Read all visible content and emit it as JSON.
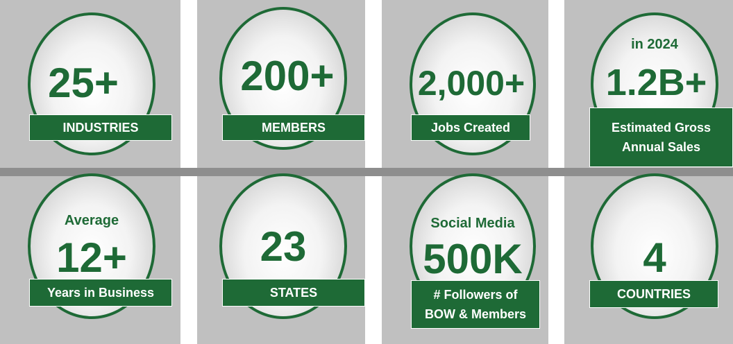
{
  "colors": {
    "green": "#1e6a36",
    "panel": "#c0c0c0",
    "divider": "#8e8e8e"
  },
  "tiles": [
    {
      "pre": "",
      "value": "25+",
      "label": "INDUSTRIES"
    },
    {
      "pre": "",
      "value": "200+",
      "label": "MEMBERS"
    },
    {
      "pre": "",
      "value": "2,000+",
      "label": "Jobs Created"
    },
    {
      "pre": "in 2024",
      "value": "1.2B+",
      "label": "Estimated Gross\nAnnual Sales"
    },
    {
      "pre": "Average",
      "value": "12+",
      "label": "Years in  Business"
    },
    {
      "pre": "",
      "value": "23",
      "label": "STATES"
    },
    {
      "pre": "Social Media",
      "value": "500K",
      "label": "# Followers of\nBOW & Members"
    },
    {
      "pre": "",
      "value": "4",
      "label": "COUNTRIES"
    }
  ]
}
